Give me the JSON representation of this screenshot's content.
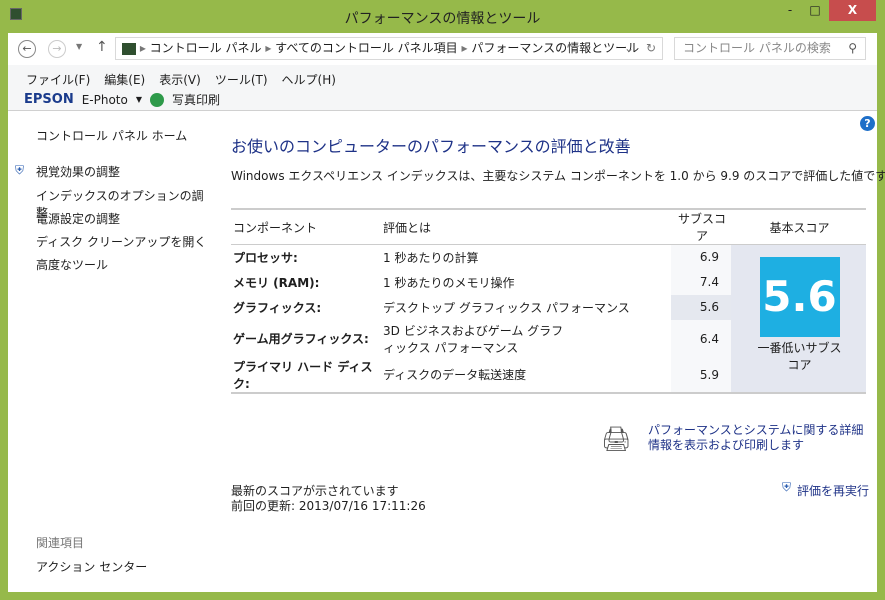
{
  "window": {
    "title": "パフォーマンスの情報とツール",
    "minimize": "-",
    "maximize": "□",
    "close": "X"
  },
  "address": {
    "crumbs": [
      "コントロール パネル",
      "すべてのコントロール パネル項目",
      "パフォーマンスの情報とツール"
    ],
    "search_placeholder": "コントロール パネルの検索"
  },
  "menu": [
    "ファイル(F)",
    "編集(E)",
    "表示(V)",
    "ツール(T)",
    "ヘルプ(H)"
  ],
  "epson": {
    "logo": "EPSON",
    "app": "E-Photo",
    "print": "写真印刷"
  },
  "sidebar": {
    "home": "コントロール パネル ホーム",
    "items": [
      "視覚効果の調整",
      "インデックスのオプションの調整",
      "電源設定の調整",
      "ディスク クリーンアップを開く",
      "高度なツール"
    ],
    "related_title": "関連項目",
    "related": [
      "アクション センター"
    ]
  },
  "main": {
    "title": "お使いのコンピューターのパフォーマンスの評価と改善",
    "description": "Windows エクスペリエンス インデックスは、主要なシステム コンポーネントを 1.0 から 9.9 のスコアで評価した値です。",
    "headers": [
      "コンポーネント",
      "評価とは",
      "サブスコア",
      "基本スコア"
    ],
    "rows": [
      {
        "component": "プロセッサ:",
        "what": "1 秒あたりの計算",
        "score": "6.9"
      },
      {
        "component": "メモリ (RAM):",
        "what": "1 秒あたりのメモリ操作",
        "score": "7.4"
      },
      {
        "component": "グラフィックス:",
        "what": "デスクトップ グラフィックス パフォーマンス",
        "score": "5.6"
      },
      {
        "component": "ゲーム用グラフィックス:",
        "what": "3D ビジネスおよびゲーム グラフィックス パフォーマンス",
        "score": "6.4"
      },
      {
        "component": "プライマリ ハード ディスク:",
        "what": "ディスクのデータ転送速度",
        "score": "5.9"
      }
    ],
    "base_score": "5.6",
    "base_caption": "一番低いサブスコア",
    "details_link": "パフォーマンスとシステムに関する詳細情報を表示および印刷します",
    "status": "最新のスコアが示されています",
    "last_update": "前回の更新: 2013/07/16 17:11:26",
    "rerun": "評価を再実行"
  }
}
